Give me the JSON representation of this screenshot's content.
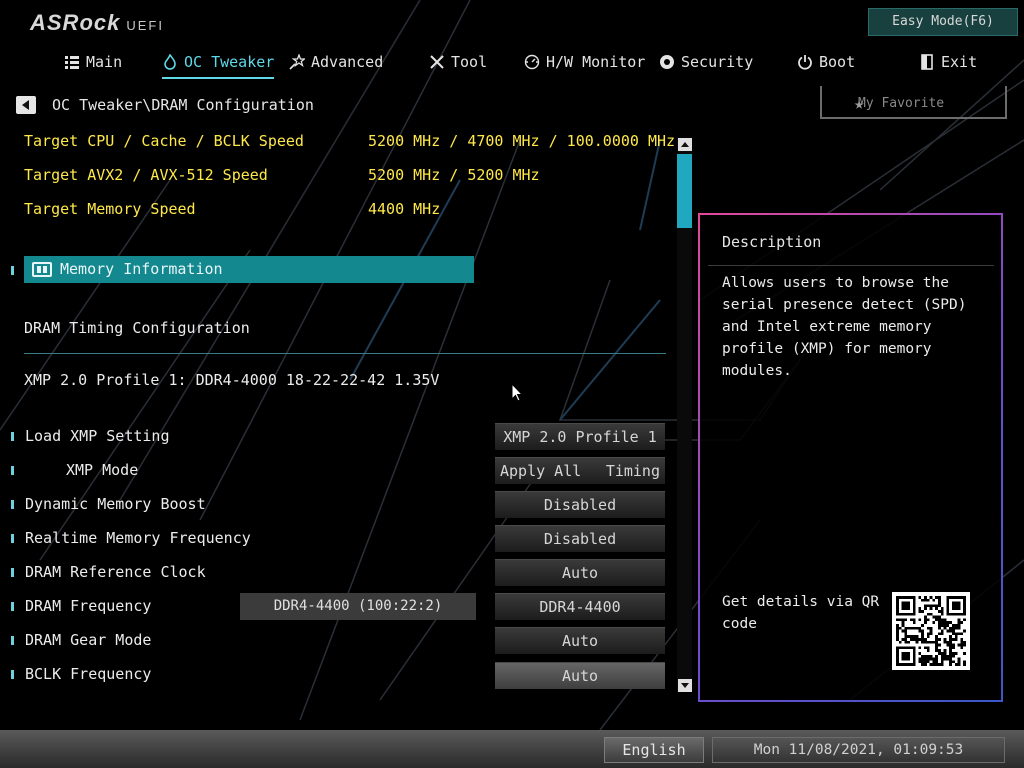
{
  "brand": {
    "logo": "ASRock",
    "logo_suffix": "UEFI"
  },
  "easy_mode_label": "Easy Mode(F6)",
  "nav": [
    {
      "label": "Main",
      "icon": "list-icon"
    },
    {
      "label": "OC Tweaker",
      "icon": "flame-icon",
      "active": true
    },
    {
      "label": "Advanced",
      "icon": "star-wand-icon"
    },
    {
      "label": "Tool",
      "icon": "tools-icon"
    },
    {
      "label": "H/W Monitor",
      "icon": "monitor-gauge-icon"
    },
    {
      "label": "Security",
      "icon": "shield-icon"
    },
    {
      "label": "Boot",
      "icon": "power-icon"
    },
    {
      "label": "Exit",
      "icon": "exit-door-icon"
    }
  ],
  "breadcrumb": "OC Tweaker\\DRAM Configuration",
  "favorite_label": "My Favorite",
  "targets": [
    {
      "label": "Target CPU / Cache / BCLK Speed",
      "value": "5200 MHz / 4700 MHz / 100.0000 MHz"
    },
    {
      "label": "Target AVX2 / AVX-512 Speed",
      "value": "5200 MHz / 5200 MHz"
    },
    {
      "label": "Target Memory Speed",
      "value": "4400 MHz"
    }
  ],
  "memory_info_label": "Memory Information",
  "dram_timing_label": "DRAM Timing Configuration",
  "xmp_profile_info": "XMP 2.0 Profile 1: DDR4-4000 18-22-22-42 1.35V",
  "settings": [
    {
      "label": "Load XMP Setting",
      "value": "XMP 2.0 Profile 1"
    },
    {
      "label": "XMP Mode",
      "value_left": "Apply All",
      "value_right": "Timing"
    },
    {
      "label": "Dynamic Memory Boost",
      "value": "Disabled"
    },
    {
      "label": "Realtime Memory Frequency",
      "value": "Disabled"
    },
    {
      "label": "DRAM Reference Clock",
      "value": "Auto"
    },
    {
      "label": "DRAM Frequency",
      "info": "DDR4-4400 (100:22:2)",
      "value": "DDR4-4400"
    },
    {
      "label": "DRAM Gear Mode",
      "value": "Auto"
    },
    {
      "label": "BCLK Frequency",
      "value": "Auto",
      "selected": true
    }
  ],
  "description": {
    "title": "Description",
    "body": "Allows users to browse the serial presence detect (SPD) and Intel extreme memory profile (XMP) for memory modules.",
    "qr_text": "Get details via QR code"
  },
  "footer": {
    "language": "English",
    "datetime": "Mon 11/08/2021, 01:09:53"
  },
  "colors": {
    "accent": "#14888f",
    "highlight_text": "#ffe84a",
    "active_tab": "#5fd8e8"
  }
}
